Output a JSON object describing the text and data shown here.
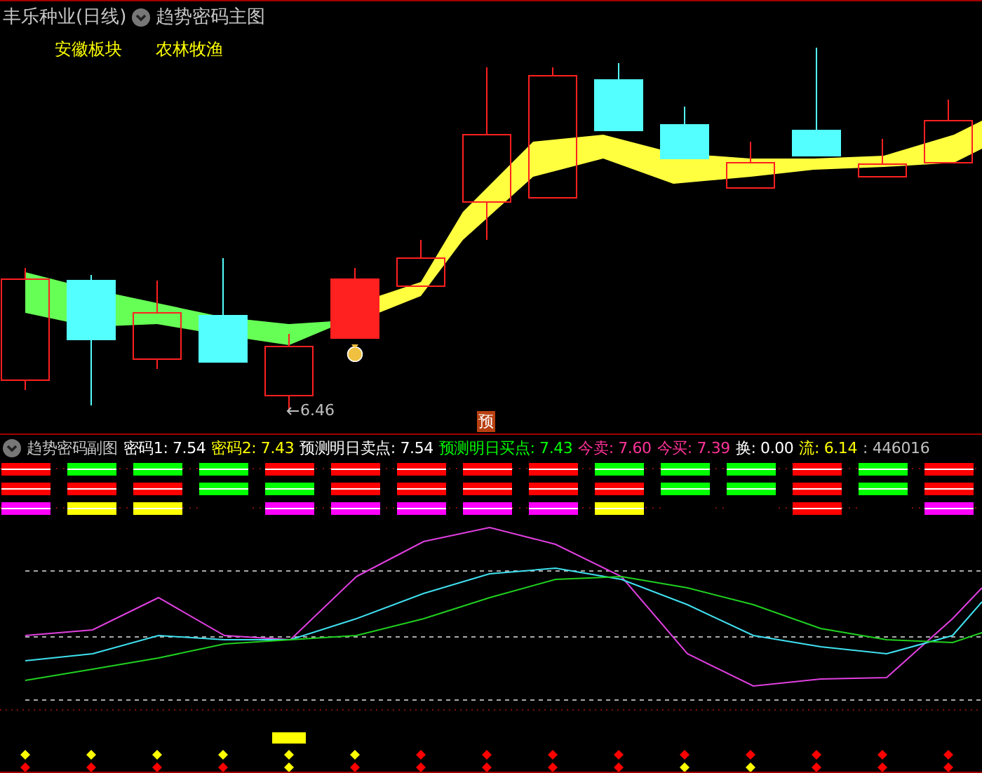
{
  "main_chart": {
    "title": "丰乐种业(日线)",
    "indicator": "趋势密码主图",
    "tags": [
      "安徽板块",
      "农林牧渔"
    ],
    "low_label": "6.46",
    "badge": "预"
  },
  "sub_chart": {
    "title": "趋势密码副图",
    "readings": [
      {
        "text": "密码1: 7.54",
        "color": "#ffffff"
      },
      {
        "text": "密码2: 7.43",
        "color": "#ffff00"
      },
      {
        "text": "预测明日卖点: 7.54",
        "color": "#ffffff"
      },
      {
        "text": "预测明日买点: 7.43",
        "color": "#00ff00"
      },
      {
        "text": "今卖: 7.60",
        "color": "#ff3399"
      },
      {
        "text": "今买: 7.39",
        "color": "#ff3399"
      },
      {
        "text": "换: 0.00",
        "color": "#ffffff"
      },
      {
        "text": "流: 6.14",
        "color": "#ffff00"
      },
      {
        "text": ": 446016",
        "color": "#c0c0c0"
      }
    ],
    "signal_rows": [
      {
        "cells": [
          {
            "on": true,
            "color": "#ff0000"
          },
          {
            "on": true,
            "color": "#00ff00"
          },
          {
            "on": true,
            "color": "#00ff00"
          },
          {
            "on": true,
            "color": "#00ff00"
          },
          {
            "on": true,
            "color": "#ff0000"
          },
          {
            "on": true,
            "color": "#ff0000"
          },
          {
            "on": true,
            "color": "#ff0000"
          },
          {
            "on": true,
            "color": "#ff0000"
          },
          {
            "on": true,
            "color": "#ff0000"
          },
          {
            "on": true,
            "color": "#00ff00"
          },
          {
            "on": true,
            "color": "#00ff00"
          },
          {
            "on": true,
            "color": "#00ff00"
          },
          {
            "on": true,
            "color": "#ff0000"
          },
          {
            "on": true,
            "color": "#00ff00"
          },
          {
            "on": true,
            "color": "#ff0000"
          }
        ]
      },
      {
        "cells": [
          {
            "on": true,
            "color": "#ff0000"
          },
          {
            "on": true,
            "color": "#ff0000"
          },
          {
            "on": true,
            "color": "#ff0000"
          },
          {
            "on": true,
            "color": "#00ff00"
          },
          {
            "on": true,
            "color": "#00ff00"
          },
          {
            "on": true,
            "color": "#ff0000"
          },
          {
            "on": true,
            "color": "#ff0000"
          },
          {
            "on": true,
            "color": "#ff0000"
          },
          {
            "on": true,
            "color": "#ff0000"
          },
          {
            "on": true,
            "color": "#ff0000"
          },
          {
            "on": true,
            "color": "#00ff00"
          },
          {
            "on": true,
            "color": "#00ff00"
          },
          {
            "on": true,
            "color": "#ff0000"
          },
          {
            "on": true,
            "color": "#00ff00"
          },
          {
            "on": true,
            "color": "#ff0000"
          }
        ]
      },
      {
        "cells": [
          {
            "on": true,
            "color": "#ff00ff"
          },
          {
            "on": true,
            "color": "#ffff00"
          },
          {
            "on": true,
            "color": "#ffff00"
          },
          {
            "on": false
          },
          {
            "on": true,
            "color": "#ff00ff"
          },
          {
            "on": true,
            "color": "#ff00ff"
          },
          {
            "on": true,
            "color": "#ff00ff"
          },
          {
            "on": true,
            "color": "#ff00ff"
          },
          {
            "on": true,
            "color": "#ff00ff"
          },
          {
            "on": true,
            "color": "#ffff00"
          },
          {
            "on": false
          },
          {
            "on": false
          },
          {
            "on": true,
            "color": "#ff0000"
          },
          {
            "on": false
          },
          {
            "on": true,
            "color": "#ff00ff"
          }
        ]
      }
    ],
    "marker_rows": [
      {
        "markers": [
          {
            "color": "#ffff00"
          },
          {
            "color": "#ffff00"
          },
          {
            "color": "#ffff00"
          },
          {
            "color": "#ffff00"
          },
          {
            "color": "#ffff00"
          },
          {
            "color": "#ffff00"
          },
          {
            "color": "#ff0000"
          },
          {
            "color": "#ff0000"
          },
          {
            "color": "#ff0000"
          },
          {
            "color": "#ff0000"
          },
          {
            "color": "#ff0000"
          },
          {
            "color": "#ff0000"
          },
          {
            "color": "#ff0000"
          },
          {
            "color": "#ff0000"
          },
          {
            "color": "#ff0000"
          }
        ]
      },
      {
        "markers": [
          {
            "color": "#ff0000"
          },
          {
            "color": "#ff0000"
          },
          {
            "color": "#ff0000"
          },
          {
            "color": "#ff0000"
          },
          {
            "color": "#ffff00"
          },
          {
            "color": "#ff0000"
          },
          {
            "color": "#ff0000"
          },
          {
            "color": "#ff0000"
          },
          {
            "color": "#ff0000"
          },
          {
            "color": "#ff0000"
          },
          {
            "color": "#ffff00"
          },
          {
            "color": "#ffff00"
          },
          {
            "color": "#ff0000"
          },
          {
            "color": "#ff0000"
          },
          {
            "color": "#ff0000"
          }
        ]
      }
    ]
  }
}
